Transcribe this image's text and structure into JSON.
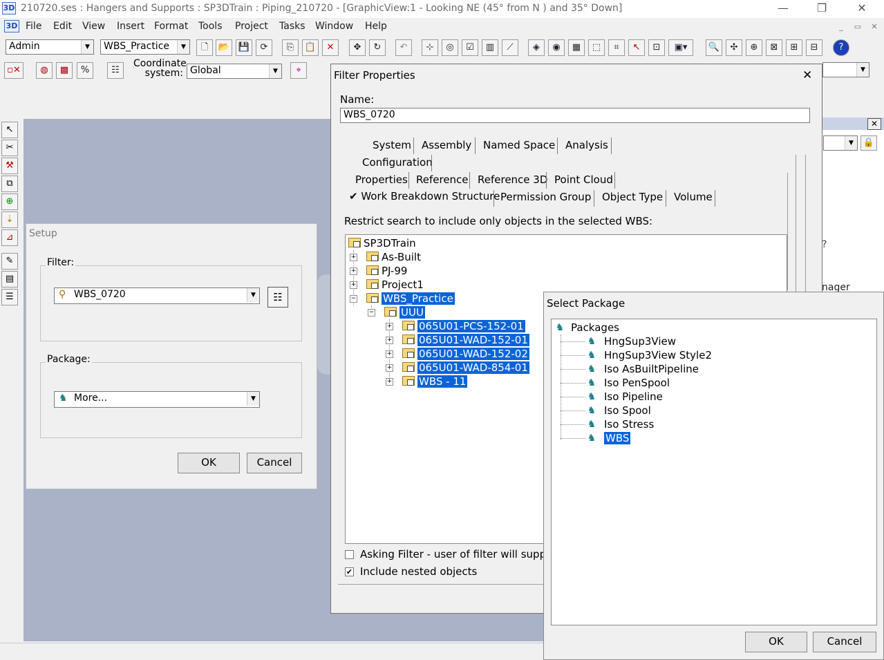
{
  "window": {
    "app_icon": "3D",
    "title": "210720.ses : Hangers and Supports : SP3DTrain : Piping_210720 - [GraphicView:1 - Looking NE (45° from N ) and 35° Down]",
    "minimize": "—",
    "restore": "❐",
    "close": "✕"
  },
  "menu": {
    "app_icon": "3D",
    "items": [
      "File",
      "Edit",
      "View",
      "Insert",
      "Format",
      "Tools",
      "Project",
      "Tasks",
      "Window",
      "Help"
    ]
  },
  "toolbar": {
    "permission_group": "Admin",
    "filter": "WBS_Practice",
    "coordinate_label_1": "Coordinate",
    "coordinate_label_2": "system:",
    "coordinate_value": "Global"
  },
  "setup": {
    "title": "Setup",
    "filter_label": "Filter:",
    "filter_value": "WBS_0720",
    "package_label": "Package:",
    "package_value": "More...",
    "ok": "OK",
    "cancel": "Cancel"
  },
  "filter_properties": {
    "title": "Filter Properties",
    "name_label": "Name:",
    "name_value": "WBS_0720",
    "tabs_row1": [
      "System",
      "Assembly",
      "Named Space",
      "Analysis"
    ],
    "tabs_row2": [
      "Configuration"
    ],
    "tabs_row3": [
      "Properties",
      "Reference",
      "Reference 3D",
      "Point Cloud"
    ],
    "tabs_row4": [
      "Work Breakdown Structure",
      "Permission Group",
      "Object Type",
      "Volume"
    ],
    "active_tab_mark": "✔",
    "restrict_text": "Restrict search to include only objects in the selected WBS:",
    "tree": {
      "root": "SP3DTrain",
      "children": [
        "As-Built",
        "PJ-99",
        "Project1",
        "WBS_Practice"
      ],
      "sub": "UUU",
      "leaves": [
        "065U01-PCS-152-01",
        "065U01-WAD-152-01",
        "065U01-WAD-152-02",
        "065U01-WAD-854-01",
        "WBS - 11"
      ]
    },
    "asking_filter": "Asking Filter - user of filter will supply",
    "include_nested": "Include nested objects"
  },
  "select_package": {
    "title": "Select Package",
    "root": "Packages",
    "items": [
      "HngSup3View",
      "HngSup3View Style2",
      "Iso AsBuiltPipeline",
      "Iso PenSpool",
      "Iso Pipeline",
      "Iso Spool",
      "Iso Stress",
      "WBS"
    ],
    "ok": "OK",
    "cancel": "Cancel"
  },
  "right_pane": {
    "partial_text": "nager",
    "question_mark": "?"
  },
  "colors": {
    "selection": "#0a64d7",
    "graphic_bg": "#a9b2c7",
    "dialog_bg": "#f0f0f0"
  }
}
